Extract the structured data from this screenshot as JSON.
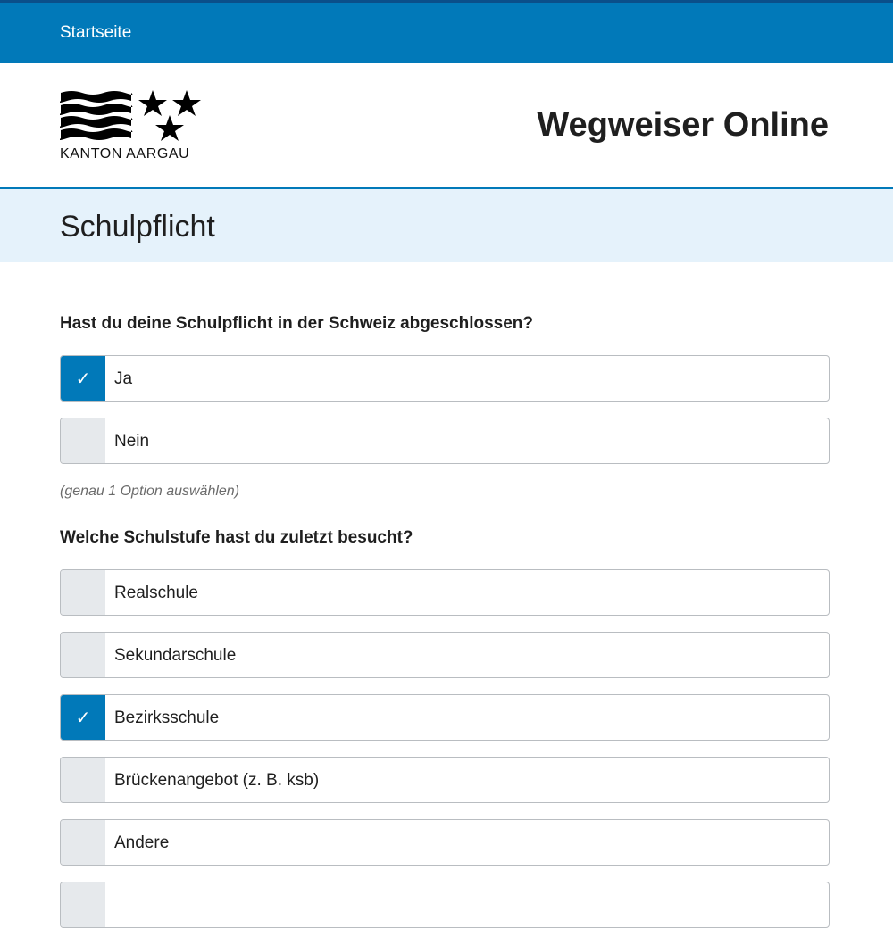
{
  "topbar": {
    "home_link": "Startseite"
  },
  "header": {
    "logo_text": "KANTON AARGAU",
    "site_title": "Wegweiser Online"
  },
  "page": {
    "title": "Schulpflicht"
  },
  "questions": [
    {
      "text": "Hast du deine Schulpflicht in der Schweiz abgeschlossen?",
      "hint": "(genau 1 Option auswählen)",
      "options": [
        {
          "label": "Ja",
          "checked": true
        },
        {
          "label": "Nein",
          "checked": false
        }
      ]
    },
    {
      "text": "Welche Schulstufe hast du zuletzt besucht?",
      "options": [
        {
          "label": "Realschule",
          "checked": false
        },
        {
          "label": "Sekundarschule",
          "checked": false
        },
        {
          "label": "Bezirksschule",
          "checked": true
        },
        {
          "label": "Brückenangebot (z. B. ksb)",
          "checked": false
        },
        {
          "label": "Andere",
          "checked": false
        },
        {
          "label": "",
          "checked": false
        }
      ]
    }
  ],
  "icons": {
    "check": "checkmark-icon",
    "logo_waves": "waves-icon",
    "logo_stars": "star-icon"
  },
  "colors": {
    "accent": "#0179b9",
    "banner": "#e5f2fb",
    "unchecked_box": "#e6e9ec"
  }
}
